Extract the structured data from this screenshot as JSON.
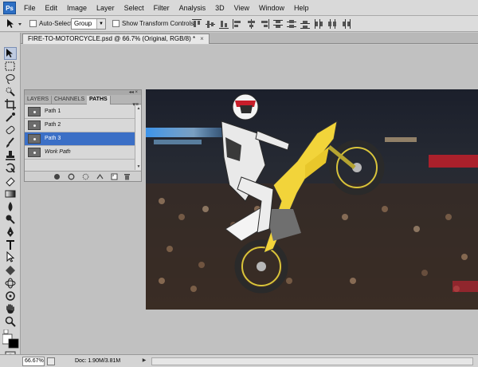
{
  "app": {
    "logo": "Ps"
  },
  "menu": [
    "File",
    "Edit",
    "Image",
    "Layer",
    "Select",
    "Filter",
    "Analysis",
    "3D",
    "View",
    "Window",
    "Help"
  ],
  "options_bar": {
    "auto_select_label": "Auto-Select:",
    "auto_select_value": "Group",
    "show_transform_label": "Show Transform Controls"
  },
  "document": {
    "tab_title": "FIRE-TO-MOTORCYCLE.psd @ 66.7% (Original, RGB/8) *",
    "close_glyph": "×"
  },
  "paths_panel": {
    "tabs": [
      "LAYERS",
      "CHANNELS",
      "PATHS"
    ],
    "active_tab": "PATHS",
    "menu_glyph": "▾≡",
    "collapse_glyph": "◂◂ ×",
    "items": [
      {
        "label": "Path 1"
      },
      {
        "label": "Path 2"
      },
      {
        "label": "Path 3",
        "selected": true
      },
      {
        "label": "Work Path",
        "italic": true
      }
    ]
  },
  "status": {
    "zoom": "66.67%",
    "doc": "Doc: 1.90M/3.81M",
    "arrow": "▶"
  },
  "colors": {
    "selection": "#3b6fc6",
    "bike_yellow": "#f2d43a"
  }
}
